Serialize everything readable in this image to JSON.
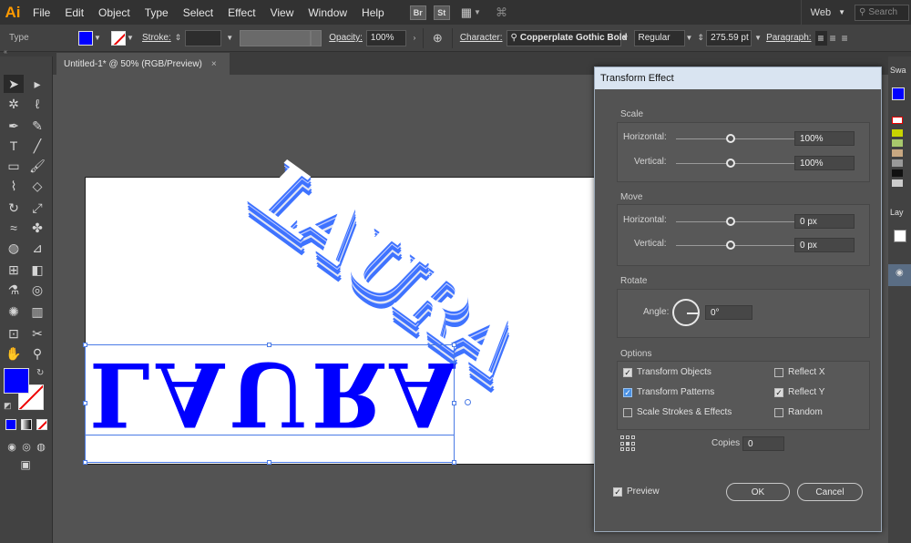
{
  "app": {
    "logo": "Ai",
    "menu": [
      "File",
      "Edit",
      "Object",
      "Type",
      "Select",
      "Effect",
      "View",
      "Window",
      "Help"
    ],
    "badges": [
      "Br",
      "St"
    ],
    "workspace": "Web",
    "search_placeholder": "Search"
  },
  "control_bar": {
    "type_label": "Type",
    "fill_color": "#0000ff",
    "stroke_label": "Stroke:",
    "opacity_label": "Opacity:",
    "opacity_value": "100%",
    "character_label": "Character:",
    "font_family": "Copperplate Gothic Bold",
    "font_style": "Regular",
    "font_size": "275.59 pt",
    "paragraph_label": "Paragraph:"
  },
  "document": {
    "tab_title": "Untitled-1* @ 50% (RGB/Preview)",
    "tab_close": "×",
    "artwork_text": "LAURA",
    "text_color": "#0000ff",
    "extrude_color": "#3f73ff"
  },
  "dialog": {
    "title": "Transform Effect",
    "scale": {
      "label": "Scale",
      "horizontal_label": "Horizontal:",
      "horizontal_value": "100%",
      "horizontal_level": 0.5,
      "vertical_label": "Vertical:",
      "vertical_value": "100%",
      "vertical_level": 0.5
    },
    "move": {
      "label": "Move",
      "horizontal_label": "Horizontal:",
      "horizontal_value": "0 px",
      "horizontal_level": 0.5,
      "vertical_label": "Vertical:",
      "vertical_value": "0 px",
      "vertical_level": 0.5
    },
    "rotate": {
      "label": "Rotate",
      "angle_label": "Angle:",
      "angle_value": "0°"
    },
    "options": {
      "label": "Options",
      "transform_objects": {
        "label": "Transform Objects",
        "checked": true
      },
      "transform_patterns": {
        "label": "Transform Patterns",
        "checked": true
      },
      "scale_strokes": {
        "label": "Scale Strokes & Effects",
        "checked": false
      },
      "reflect_x": {
        "label": "Reflect X",
        "checked": false
      },
      "reflect_y": {
        "label": "Reflect Y",
        "checked": true
      },
      "random": {
        "label": "Random",
        "checked": false
      }
    },
    "copies_label": "Copies",
    "copies_value": "0",
    "preview": {
      "label": "Preview",
      "checked": true
    },
    "ok_label": "OK",
    "cancel_label": "Cancel"
  },
  "right_panel": {
    "swatches_tab": "Swa",
    "layers_tab": "Lay"
  }
}
